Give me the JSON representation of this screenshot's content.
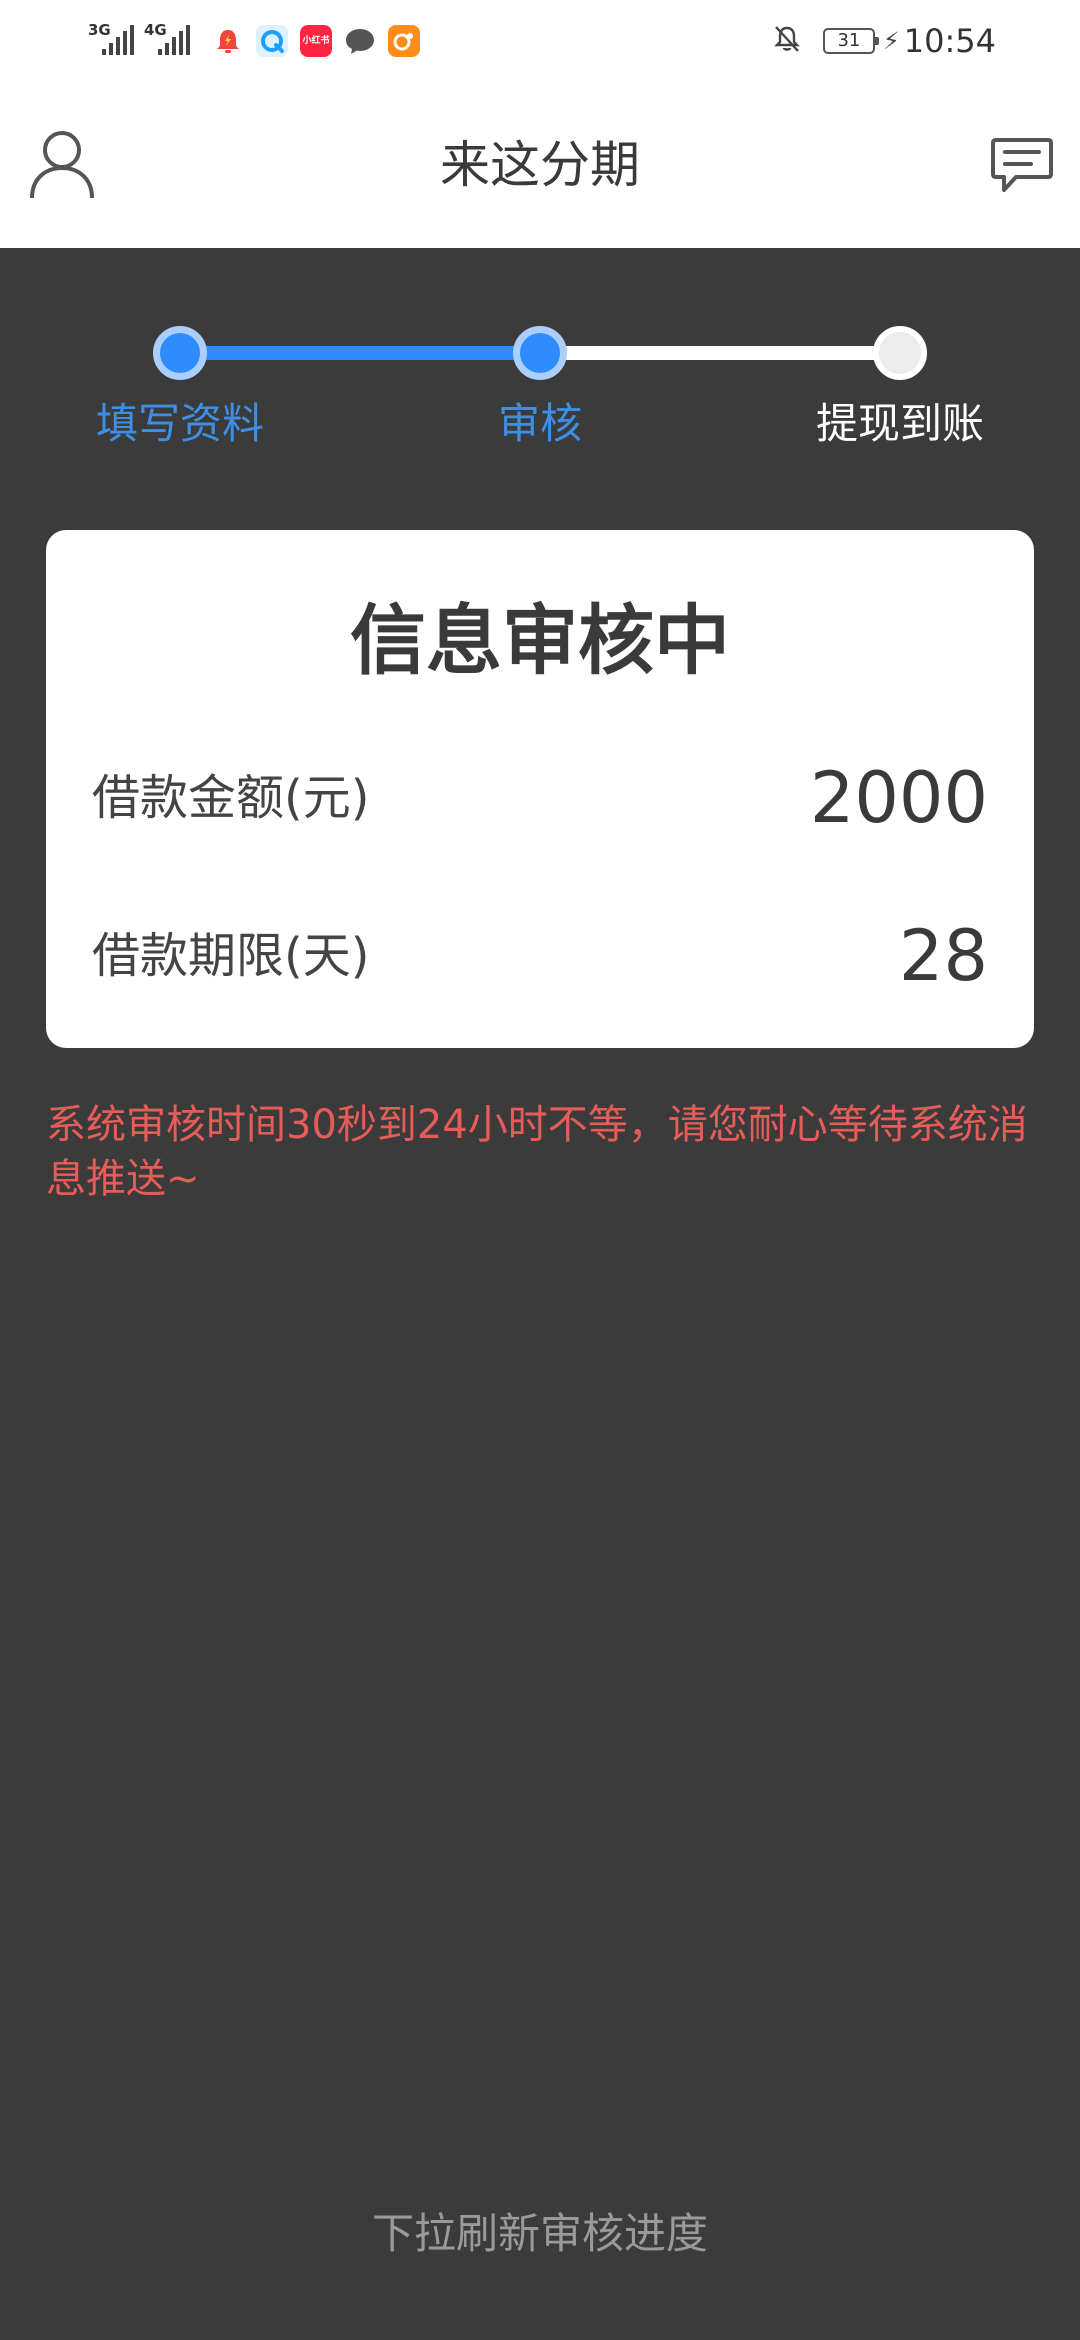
{
  "status_bar": {
    "signal_1": "3G",
    "signal_2": "4G",
    "app_icon_xhs": "小红书",
    "battery": "31",
    "time": "10:54"
  },
  "header": {
    "title": "来这分期"
  },
  "steps": [
    {
      "label": "填写资料",
      "state": "done"
    },
    {
      "label": "审核",
      "state": "current"
    },
    {
      "label": "提现到账",
      "state": "pending"
    }
  ],
  "card": {
    "title": "信息审核中",
    "amount_label": "借款金额(元)",
    "amount_value": "2000",
    "term_label": "借款期限(天)",
    "term_value": "28"
  },
  "notice": "系统审核时间30秒到24小时不等，请您耐心等待系统消息推送~",
  "refresh_hint": "下拉刷新审核进度",
  "colors": {
    "accent_blue": "#2f8cff",
    "background": "#3b3b3c",
    "notice_red": "#e85c57"
  }
}
